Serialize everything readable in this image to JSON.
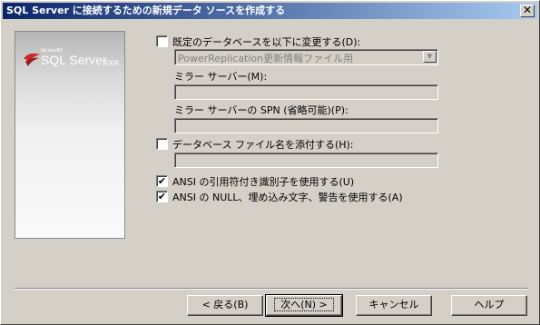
{
  "window": {
    "title": "SQL Server に接続するための新規データ ソースを作成する",
    "close_glyph": "✕"
  },
  "banner": {
    "brand_small": "Microsoft®",
    "brand_main": "SQL Server",
    "brand_year": "2008"
  },
  "options": {
    "change_default_db": {
      "label": "既定のデータベースを以下に変更する(D):",
      "checked": false
    },
    "default_db_select": {
      "value": "PowerReplication更新情報ファイル用"
    },
    "mirror_server": {
      "label": "ミラー サーバー(M):",
      "value": ""
    },
    "mirror_spn": {
      "label": "ミラー サーバーの SPN (省略可能)(P):",
      "value": ""
    },
    "attach_db_file": {
      "label": "データベース ファイル名を添付する(H):",
      "checked": false
    },
    "attach_db_path": {
      "value": ""
    },
    "ansi_quoted": {
      "label": "ANSI の引用符付き識別子を使用する(U)",
      "checked": true,
      "mark": "✔"
    },
    "ansi_nulls": {
      "label": "ANSI の NULL、埋め込み文字、警告を使用する(A)",
      "checked": true,
      "mark": "✔"
    }
  },
  "buttons": {
    "back": "< 戻る(B)",
    "next": "次へ(N) >",
    "cancel": "キャンセル",
    "help": "ヘルプ"
  },
  "colors": {
    "titlebar_start": "#0a246a",
    "titlebar_end": "#a6caf0",
    "dialog_face": "#d4d0c8",
    "logo_red": "#cc2a2a"
  }
}
